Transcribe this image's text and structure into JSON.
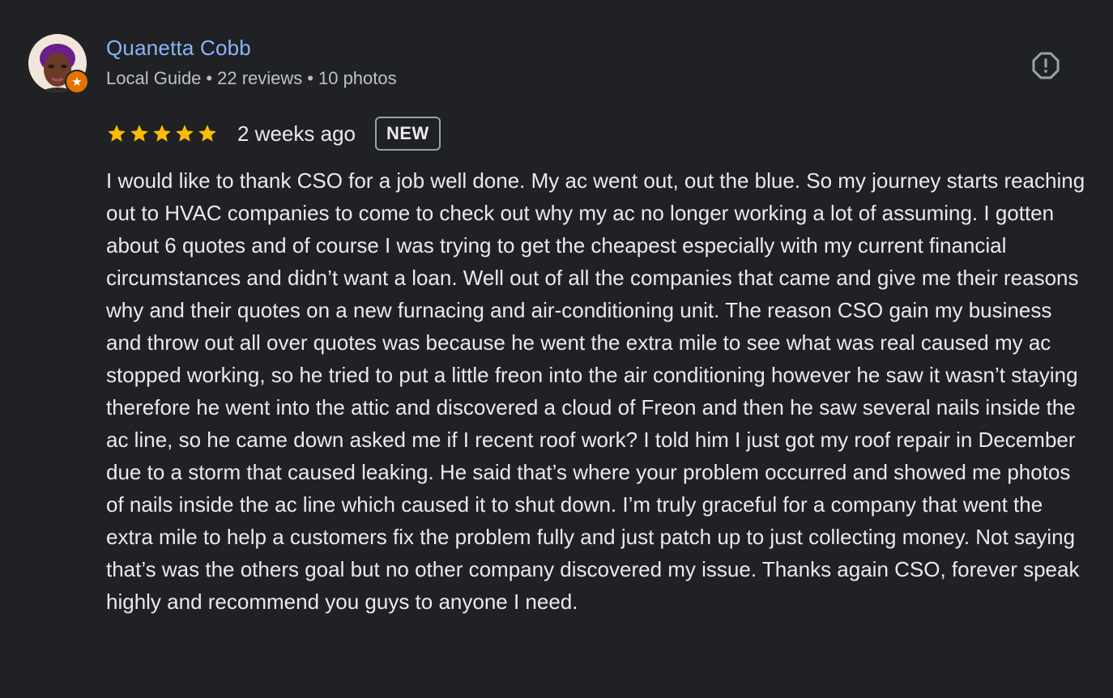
{
  "reviewer": {
    "name": "Quanetta Cobb",
    "guide_label": "Local Guide",
    "separator": "•",
    "reviews_count": "22 reviews",
    "photos_count": "10 photos",
    "avatar_icon": "user-avatar",
    "badge_icon": "local-guide-star-icon"
  },
  "review": {
    "rating": 5,
    "max_rating": 5,
    "time": "2 weeks ago",
    "new_badge": "NEW",
    "text": "I would like to thank CSO for a job well done. My ac went out, out the blue. So my journey starts reaching out to HVAC companies to come to check out why my ac no longer working a lot of assuming. I gotten about 6 quotes and of course I was trying to get the cheapest especially with my current financial circumstances and didn’t want a loan. Well out of all the companies that came and give me their reasons why and their quotes on a new furnacing and air-conditioning unit. The reason CSO gain my business and throw out all over quotes was because he went the extra mile to see what was real caused my ac stopped working, so he tried to put a little freon into the air conditioning however he saw it wasn’t staying therefore he went into the attic and discovered a cloud of Freon and then he saw several nails inside the ac line, so he came down asked me if I recent roof work? I told him I just got my roof repair in December due to a storm that caused leaking. He said that’s where your problem occurred and showed me photos of nails inside the ac line which caused it to shut down. I’m truly graceful for a company that went the extra mile to help a customers fix the problem fully and just patch up to just collecting money. Not saying that’s was the others goal but no other company discovered my issue. Thanks again CSO, forever speak highly and recommend you guys to anyone I need."
  },
  "actions": {
    "report_icon": "report-icon"
  },
  "colors": {
    "background": "#202124",
    "name_link": "#8ab4f8",
    "star": "#fbbc04",
    "text": "#e8eaed",
    "secondary_text": "#bdc1c6",
    "badge_orange": "#e37400"
  }
}
